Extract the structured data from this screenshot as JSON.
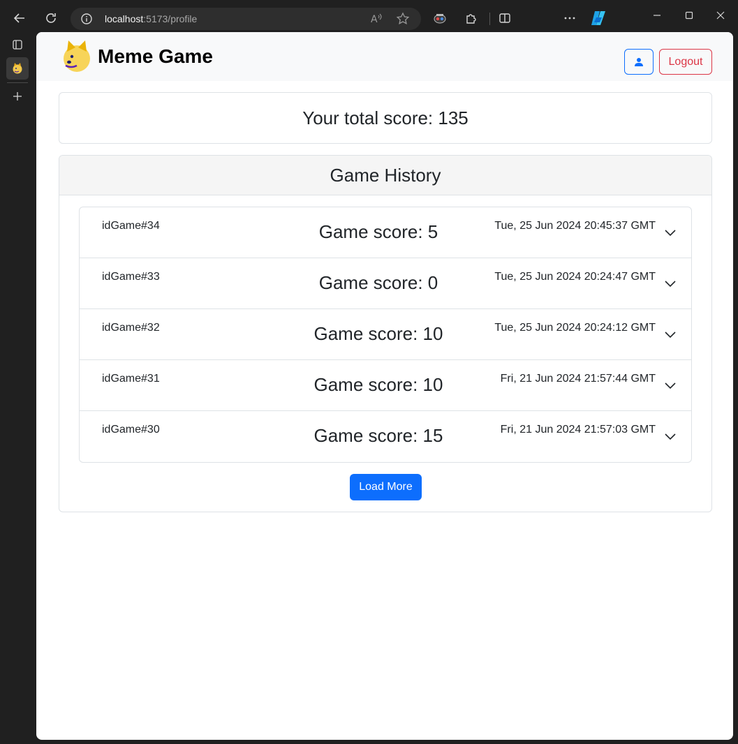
{
  "browser": {
    "url_host": "localhost",
    "url_path": ":5173/profile"
  },
  "navbar": {
    "brand": "Meme Game",
    "logout_label": "Logout"
  },
  "profile": {
    "total_score_text": "Your total score: 135"
  },
  "history": {
    "title": "Game History",
    "load_more_label": "Load More",
    "games": [
      {
        "id": "idGame#34",
        "score": "Game score: 5",
        "date": "Tue, 25 Jun 2024 20:45:37 GMT"
      },
      {
        "id": "idGame#33",
        "score": "Game score: 0",
        "date": "Tue, 25 Jun 2024 20:24:47 GMT"
      },
      {
        "id": "idGame#32",
        "score": "Game score: 10",
        "date": "Tue, 25 Jun 2024 20:24:12 GMT"
      },
      {
        "id": "idGame#31",
        "score": "Game score: 10",
        "date": "Fri, 21 Jun 2024 21:57:44 GMT"
      },
      {
        "id": "idGame#30",
        "score": "Game score: 15",
        "date": "Fri, 21 Jun 2024 21:57:03 GMT"
      }
    ]
  },
  "colors": {
    "primary": "#0d6efd",
    "danger": "#dc3545",
    "navbar_bg": "#f8f9fa"
  }
}
